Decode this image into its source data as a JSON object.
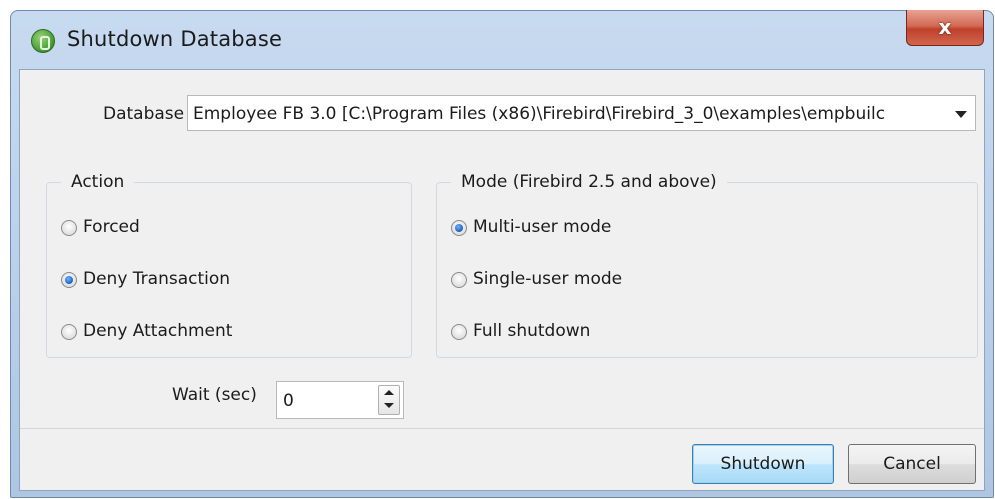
{
  "window": {
    "title": "Shutdown Database",
    "close_glyph": "x"
  },
  "database": {
    "label": "Database",
    "value": "Employee FB 3.0 [C:\\Program Files (x86)\\Firebird\\Firebird_3_0\\examples\\empbuilc"
  },
  "action": {
    "legend": "Action",
    "options": [
      {
        "label": "Forced",
        "checked": false
      },
      {
        "label": "Deny Transaction",
        "checked": true
      },
      {
        "label": "Deny Attachment",
        "checked": false
      }
    ]
  },
  "mode": {
    "legend": "Mode (Firebird 2.5 and above)",
    "options": [
      {
        "label": "Multi-user mode",
        "checked": true
      },
      {
        "label": "Single-user mode",
        "checked": false
      },
      {
        "label": "Full shutdown",
        "checked": false
      }
    ]
  },
  "wait": {
    "label": "Wait (sec)",
    "value": "0"
  },
  "buttons": {
    "shutdown_label": "Shutdown",
    "cancel_label": "Cancel"
  },
  "colors": {
    "close_button": "#c7503a",
    "title_bar": "#b9cfe9",
    "client_bg": "#f0f0f0",
    "radio_selected": "#1c5fc0"
  }
}
